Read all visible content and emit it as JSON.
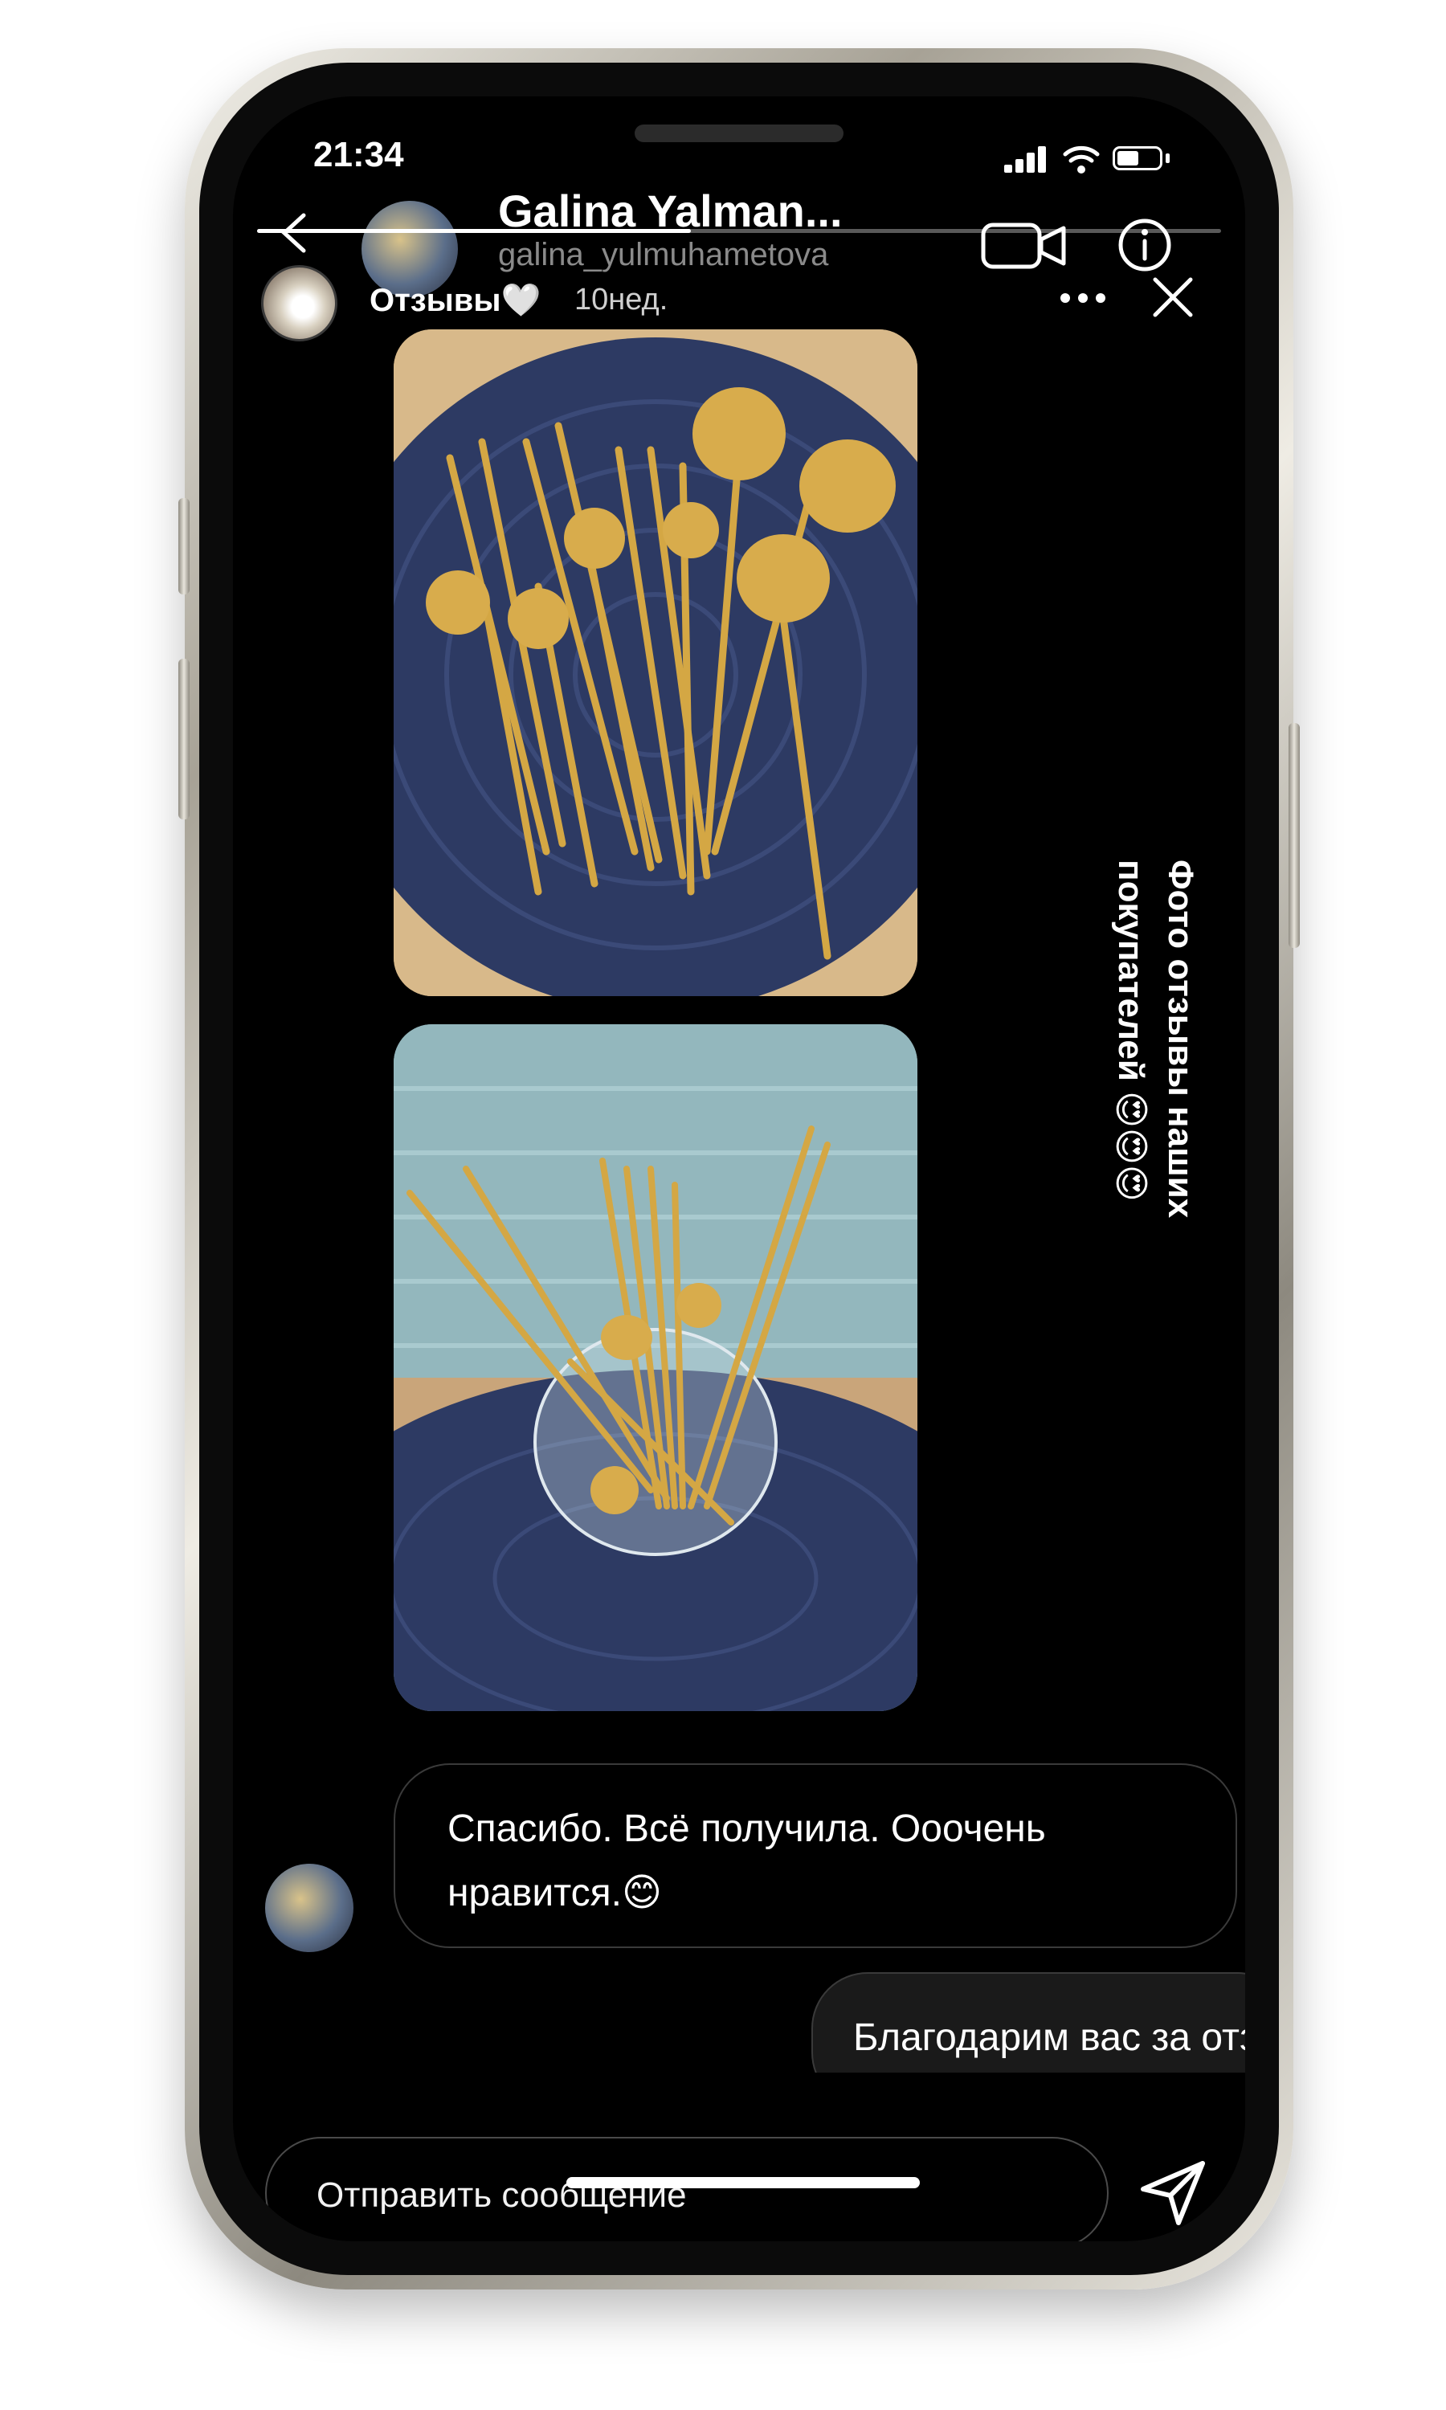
{
  "status_bar": {
    "time": "21:34"
  },
  "dm_header": {
    "name": "Galina Yalman...",
    "username": "galina_yulmuhametova"
  },
  "story": {
    "title": "Отзывы🤍",
    "age": "10нед.",
    "progress": 0.45
  },
  "caption": {
    "text": "Фото отзывы наших покупателей 😍😍😍"
  },
  "messages": {
    "received": "Спасибо. Всё получила. Ооочень нравится.😊",
    "sent": "Благодарим вас за отзыв ✨"
  },
  "composer": {
    "placeholder": "Отправить сообщение"
  },
  "colors": {
    "background": "#000000",
    "gold": "#d4a744",
    "placemat": "#2d3a63"
  }
}
